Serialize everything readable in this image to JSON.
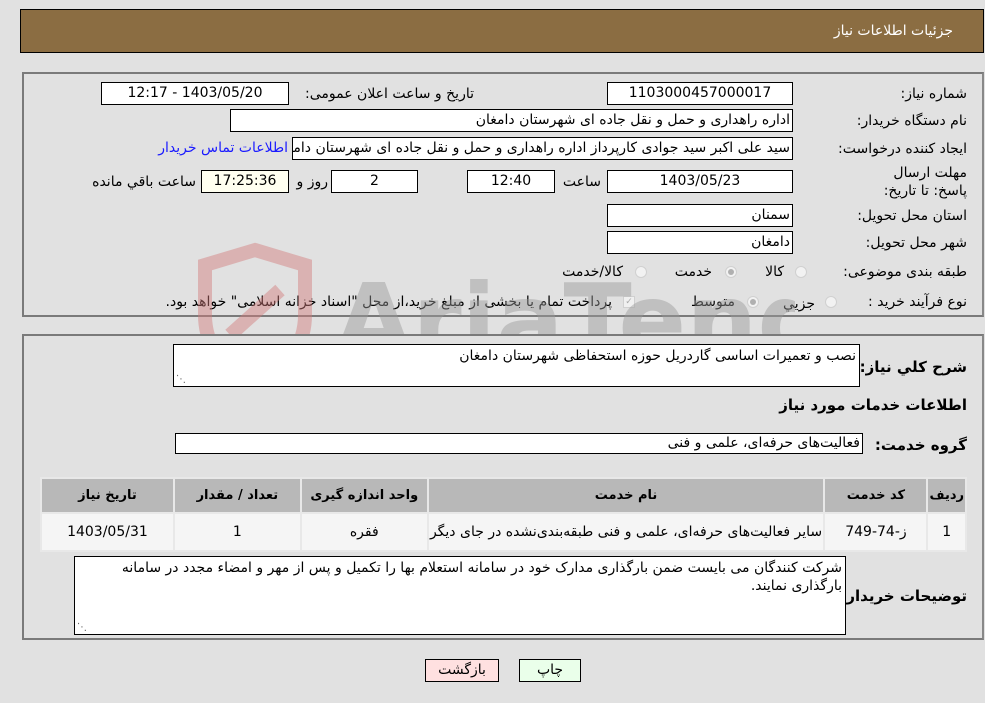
{
  "header": {
    "title": "جزئیات اطلاعات نیاز"
  },
  "fields": {
    "need_number": {
      "label": "شماره نیاز:",
      "value": "1103000457000017"
    },
    "announce_datetime": {
      "label": "تاریخ و ساعت اعلان عمومی:",
      "value": "1403/05/20 - 12:17"
    },
    "buyer_org": {
      "label": "نام دستگاه خریدار:",
      "value": "اداره راهداری و حمل و نقل جاده ای شهرستان دامغان"
    },
    "requester": {
      "label": "ایجاد کننده درخواست:",
      "value": "سید علی اکبر سید جوادی کارپرداز اداره راهداری و حمل و نقل جاده ای شهرستان دامغان"
    },
    "buyer_contact_link": "اطلاعات تماس خریدار",
    "deadline": {
      "label": "مهلت ارسال پاسخ: تا تاریخ:",
      "date": "1403/05/23",
      "time_label": "ساعت",
      "time": "12:40",
      "days": "2",
      "days_label": "روز و",
      "remaining": "17:25:36",
      "remaining_label": "ساعت باقي مانده"
    },
    "province": {
      "label": "استان محل تحویل:",
      "value": "سمنان"
    },
    "city": {
      "label": "شهر محل تحویل:",
      "value": "دامغان"
    },
    "category": {
      "label": "طبقه بندی موضوعی:",
      "options": [
        "کالا",
        "خدمت",
        "کالا/خدمت"
      ],
      "selected": "خدمت"
    },
    "purchase_type": {
      "label": "نوع فرآیند خرید :",
      "options": [
        "جزيي",
        "متوسط"
      ],
      "selected": "متوسط",
      "treasury_note": "پرداخت تمام یا بخشی از مبلغ خرید،از محل \"اسناد خزانه اسلامی\" خواهد بود.",
      "treasury_checked": true
    }
  },
  "description": {
    "label": "شرح كلي نياز:",
    "value": "نصب و تعمیرات اساسی گاردریل حوزه استحفاظی شهرستان دامغان"
  },
  "services_section": {
    "title": "اطلاعات خدمات مورد نياز"
  },
  "service_group": {
    "label": "گروه خدمت:",
    "value": "فعالیت‌های حرفه‌ای، علمی و فنی"
  },
  "table": {
    "headers": [
      "ردیف",
      "کد خدمت",
      "نام خدمت",
      "واحد اندازه گیری",
      "تعداد / مقدار",
      "تاریخ نیاز"
    ],
    "rows": [
      [
        "1",
        "ز-74-749",
        "سایر فعالیت‌های حرفه‌ای، علمی و فنی طبقه‌بندی‌نشده در جای دیگر",
        "فقره",
        "1",
        "1403/05/31"
      ]
    ]
  },
  "buyer_notes": {
    "label": "توضیحات خریدار:",
    "value": "شرکت کنندگان می بایست ضمن بارگذاری مدارک خود در سامانه استعلام بها را تکمیل و پس از مهر و امضاء مجدد در سامانه بارگذاری نمایند."
  },
  "buttons": {
    "print": "چاپ",
    "back": "بازگشت"
  },
  "watermark": {
    "text": "AriaTender.neT"
  }
}
